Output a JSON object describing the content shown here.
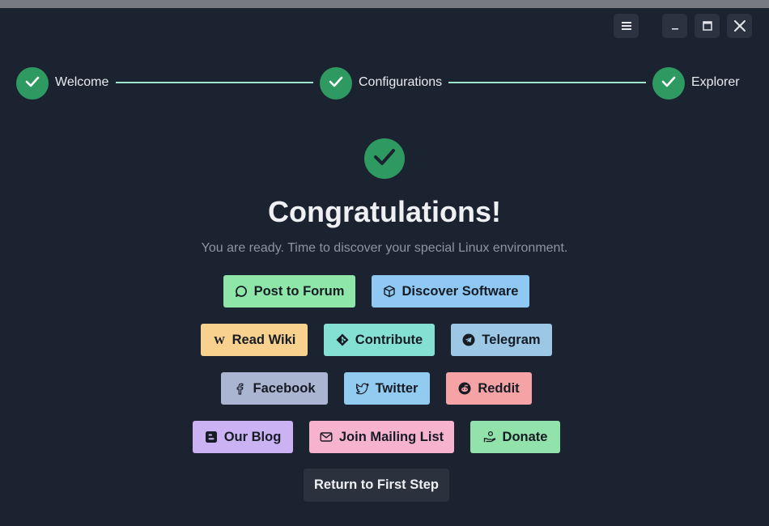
{
  "colors": {
    "background": "#1b2230",
    "accent_green": "#2e9a61",
    "step_line": "#9fe6cc"
  },
  "window_controls": [
    {
      "name": "menu",
      "icon": "hamburger-menu-icon"
    },
    {
      "name": "minimize",
      "icon": "minimize-icon"
    },
    {
      "name": "maximize",
      "icon": "maximize-icon"
    },
    {
      "name": "close",
      "icon": "close-icon"
    }
  ],
  "steps": [
    {
      "label": "Welcome",
      "status": "complete"
    },
    {
      "label": "Configurations",
      "status": "complete"
    },
    {
      "label": "Explorer",
      "status": "complete"
    }
  ],
  "main": {
    "title": "Congratulations!",
    "subtitle": "You are ready. Time to discover your special Linux environment."
  },
  "actions": {
    "post_to_forum": {
      "label": "Post to Forum",
      "icon": "forum-chat-icon",
      "color": "#8ee6a8"
    },
    "discover_software": {
      "label": "Discover Software",
      "icon": "package-icon",
      "color": "#8ec8f3"
    },
    "read_wiki": {
      "label": "Read Wiki",
      "icon": "wikipedia-icon",
      "color": "#f7d18d"
    },
    "contribute": {
      "label": "Contribute",
      "icon": "git-icon",
      "color": "#85e0d4"
    },
    "telegram": {
      "label": "Telegram",
      "icon": "telegram-icon",
      "color": "#9cc8e6"
    },
    "facebook": {
      "label": "Facebook",
      "icon": "facebook-icon",
      "color": "#aab5d2"
    },
    "twitter": {
      "label": "Twitter",
      "icon": "twitter-icon",
      "color": "#92cbf0"
    },
    "reddit": {
      "label": "Reddit",
      "icon": "reddit-icon",
      "color": "#f6a3a6"
    },
    "our_blog": {
      "label": "Our Blog",
      "icon": "blogger-icon",
      "color": "#cbb3f3"
    },
    "mailing_list": {
      "label": "Join Mailing List",
      "icon": "mail-icon",
      "color": "#f6b3cd"
    },
    "donate": {
      "label": "Donate",
      "icon": "donate-hand-icon",
      "color": "#92e3ab"
    }
  },
  "return_button": {
    "label": "Return to First Step"
  }
}
